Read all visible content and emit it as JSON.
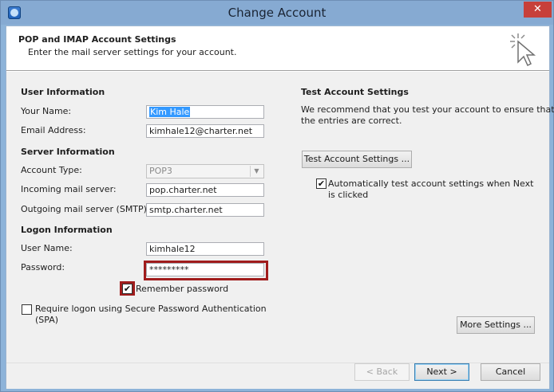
{
  "window": {
    "title": "Change Account",
    "close_glyph": "✕"
  },
  "header": {
    "title": "POP and IMAP Account Settings",
    "subtitle": "Enter the mail server settings for your account."
  },
  "user_info": {
    "heading": "User Information",
    "name_label": "Your Name:",
    "name_value": "Kim Hale",
    "email_label": "Email Address:",
    "email_value": "kimhale12@charter.net"
  },
  "server_info": {
    "heading": "Server Information",
    "account_type_label": "Account Type:",
    "account_type_value": "POP3",
    "incoming_label": "Incoming mail server:",
    "incoming_value": "pop.charter.net",
    "outgoing_label": "Outgoing mail server (SMTP):",
    "outgoing_value": "smtp.charter.net"
  },
  "logon_info": {
    "heading": "Logon Information",
    "username_label": "User Name:",
    "username_value": "kimhale12",
    "password_label": "Password:",
    "password_value": "*********",
    "remember_label": "Remember password",
    "remember_checked": true,
    "spa_label_line1": "Require logon using Secure Password Authentication",
    "spa_label_line2": "(SPA)",
    "spa_checked": false
  },
  "test_settings": {
    "heading": "Test Account Settings",
    "description_line1": "We recommend that you test your account to ensure that",
    "description_line2": "the entries are correct.",
    "test_button": "Test Account Settings ...",
    "auto_test_line1": "Automatically test account settings when Next",
    "auto_test_line2": "is clicked",
    "auto_test_checked": true,
    "more_settings_button": "More Settings ..."
  },
  "footer": {
    "back_button": "< Back",
    "next_button": "Next >",
    "cancel_button": "Cancel"
  },
  "glyphs": {
    "check": "✔",
    "dropdown": "▼"
  },
  "colors": {
    "highlight_border": "#a01c1c",
    "selection": "#3399ff",
    "titlebar": "#86aad2",
    "close": "#c7403a"
  },
  "icons": [
    "outlook-icon",
    "close-icon",
    "cursor-click-icon",
    "chevron-down-icon",
    "checkmark-icon"
  ]
}
